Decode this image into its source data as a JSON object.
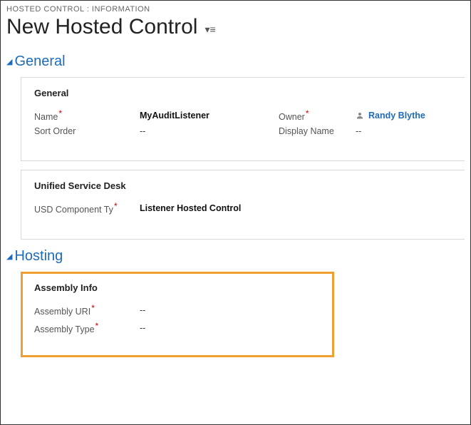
{
  "breadcrumb": "HOSTED CONTROL : INFORMATION",
  "page_title": "New Hosted Control",
  "sections": {
    "general": {
      "title": "General",
      "panels": {
        "general": {
          "title": "General",
          "fields": {
            "name_label": "Name",
            "name_value": "MyAuditListener",
            "owner_label": "Owner",
            "owner_value": "Randy Blythe",
            "sort_order_label": "Sort Order",
            "sort_order_value": "--",
            "display_name_label": "Display Name",
            "display_name_value": "--"
          }
        },
        "usd": {
          "title": "Unified Service Desk",
          "fields": {
            "component_type_label": "USD Component Ty",
            "component_type_value": "Listener Hosted Control"
          }
        }
      }
    },
    "hosting": {
      "title": "Hosting",
      "panels": {
        "assembly": {
          "title": "Assembly Info",
          "fields": {
            "uri_label": "Assembly URI",
            "uri_value": "--",
            "type_label": "Assembly Type",
            "type_value": "--"
          }
        }
      }
    }
  }
}
